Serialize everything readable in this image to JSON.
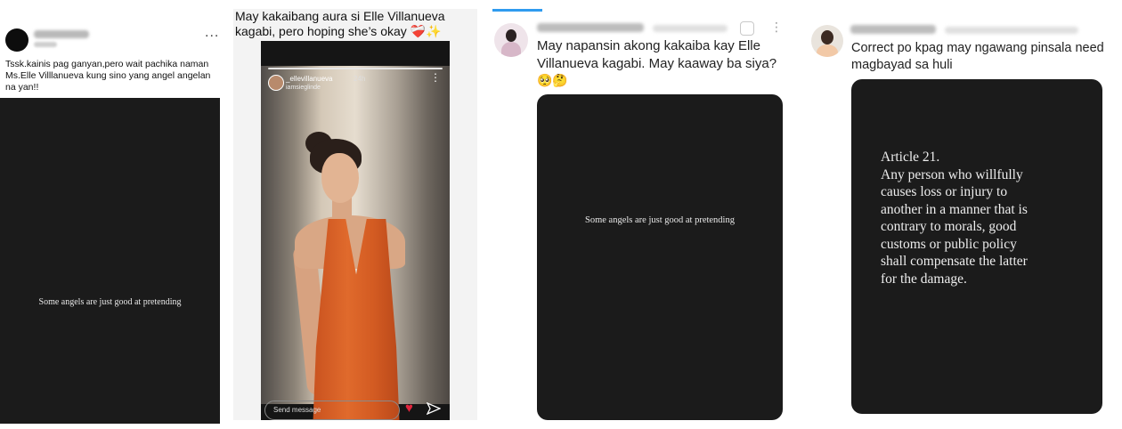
{
  "panel1": {
    "more": "...",
    "caption": "Tssk.kainis pag ganyan,pero wait pachika naman Ms.Elle Villlanueva kung sino yang angel angelan na yan!!",
    "story_text": "Some angels are just good at pretending"
  },
  "panel2": {
    "caption": "May kakaibang aura si Elle Villanueva kagabi, pero hoping she’s okay ❤️‍🩹✨",
    "username": "_ellevillanueva",
    "time": "24h",
    "music": "iamsieglinde",
    "reply_placeholder": "Send message",
    "heart": "♥"
  },
  "panel3": {
    "text": "May napansin akong kakaiba kay Elle Villanueva kagabi. May kaaway ba siya?",
    "emoji": "🥺🤔",
    "card_text": "Some angels are just good at pretending"
  },
  "panel4": {
    "text": "Correct po kpag may ngawang pinsala need magbayad sa huli",
    "law_lines": [
      "Article 21.",
      "Any person who willfully",
      "causes loss or injury to",
      "another in a manner that is",
      "contrary to morals, good",
      "customs or public policy",
      "shall compensate the latter",
      "for the damage."
    ]
  }
}
